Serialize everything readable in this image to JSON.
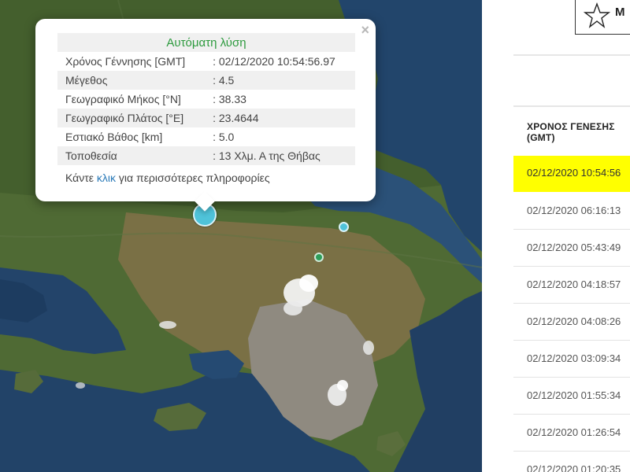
{
  "popup": {
    "close_icon": "×",
    "title": "Αυτόματη λύση",
    "rows": [
      {
        "label": "Χρόνος Γέννησης [GMT]",
        "value": ": 02/12/2020 10:54:56.97"
      },
      {
        "label": "Μέγεθος",
        "value": ": 4.5"
      },
      {
        "label": "Γεωγραφικό Μήκος [°N]",
        "value": ": 38.33"
      },
      {
        "label": "Γεωγραφικό Πλάτος [°E]",
        "value": ": 23.4644"
      },
      {
        "label": "Εστιακό Βάθος [km]",
        "value": ": 5.0"
      },
      {
        "label": "Τοποθεσία",
        "value": ": 13 Χλμ. Α της Θήβας"
      }
    ],
    "more_prefix": "Κάντε ",
    "more_link": "κλικ",
    "more_suffix": " για περισσότερες πληροφορίες"
  },
  "legend": {
    "icon": "star-icon",
    "label": "M"
  },
  "table": {
    "header_line1": "ΧΡΟΝΟΣ ΓΕΝΕΣΗΣ",
    "header_line2": "(GMT)",
    "rows": [
      "02/12/2020 10:54:56",
      "02/12/2020 06:16:13",
      "02/12/2020 05:43:49",
      "02/12/2020 04:18:57",
      "02/12/2020 04:08:26",
      "02/12/2020 03:09:34",
      "02/12/2020 01:55:34",
      "02/12/2020 01:26:54",
      "02/12/2020 01:20:35"
    ],
    "selected_index": 0,
    "highlight_color": "#ffff00"
  },
  "colors": {
    "popup_title": "#2d9a3e",
    "link": "#2a7ab8",
    "marker_cyan": "#4fc3d9",
    "marker_green": "#2e9e5a"
  }
}
